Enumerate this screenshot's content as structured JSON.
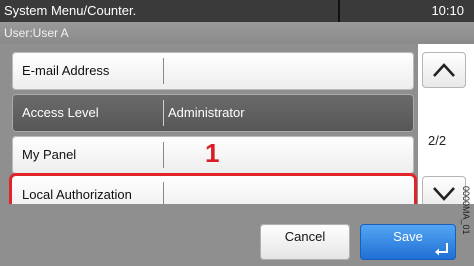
{
  "header": {
    "title": "System Menu/Counter.",
    "time": "10:10",
    "user": "User:User A"
  },
  "rows": [
    {
      "label": "E-mail Address",
      "value": ""
    },
    {
      "label": "Access Level",
      "value": "Administrator"
    },
    {
      "label": "My Panel",
      "value": ""
    },
    {
      "label": "Local Authorization",
      "value": ""
    }
  ],
  "callout": "1",
  "pager": {
    "page": "2/2"
  },
  "buttons": {
    "cancel": "Cancel",
    "save": "Save"
  },
  "side_code": "0000MA_01",
  "icons": {
    "up": "chevron-up-icon",
    "down": "chevron-down-icon",
    "enter": "enter-icon"
  },
  "colors": {
    "highlight": "#e0242a",
    "save_button": "#1f6ed4"
  }
}
